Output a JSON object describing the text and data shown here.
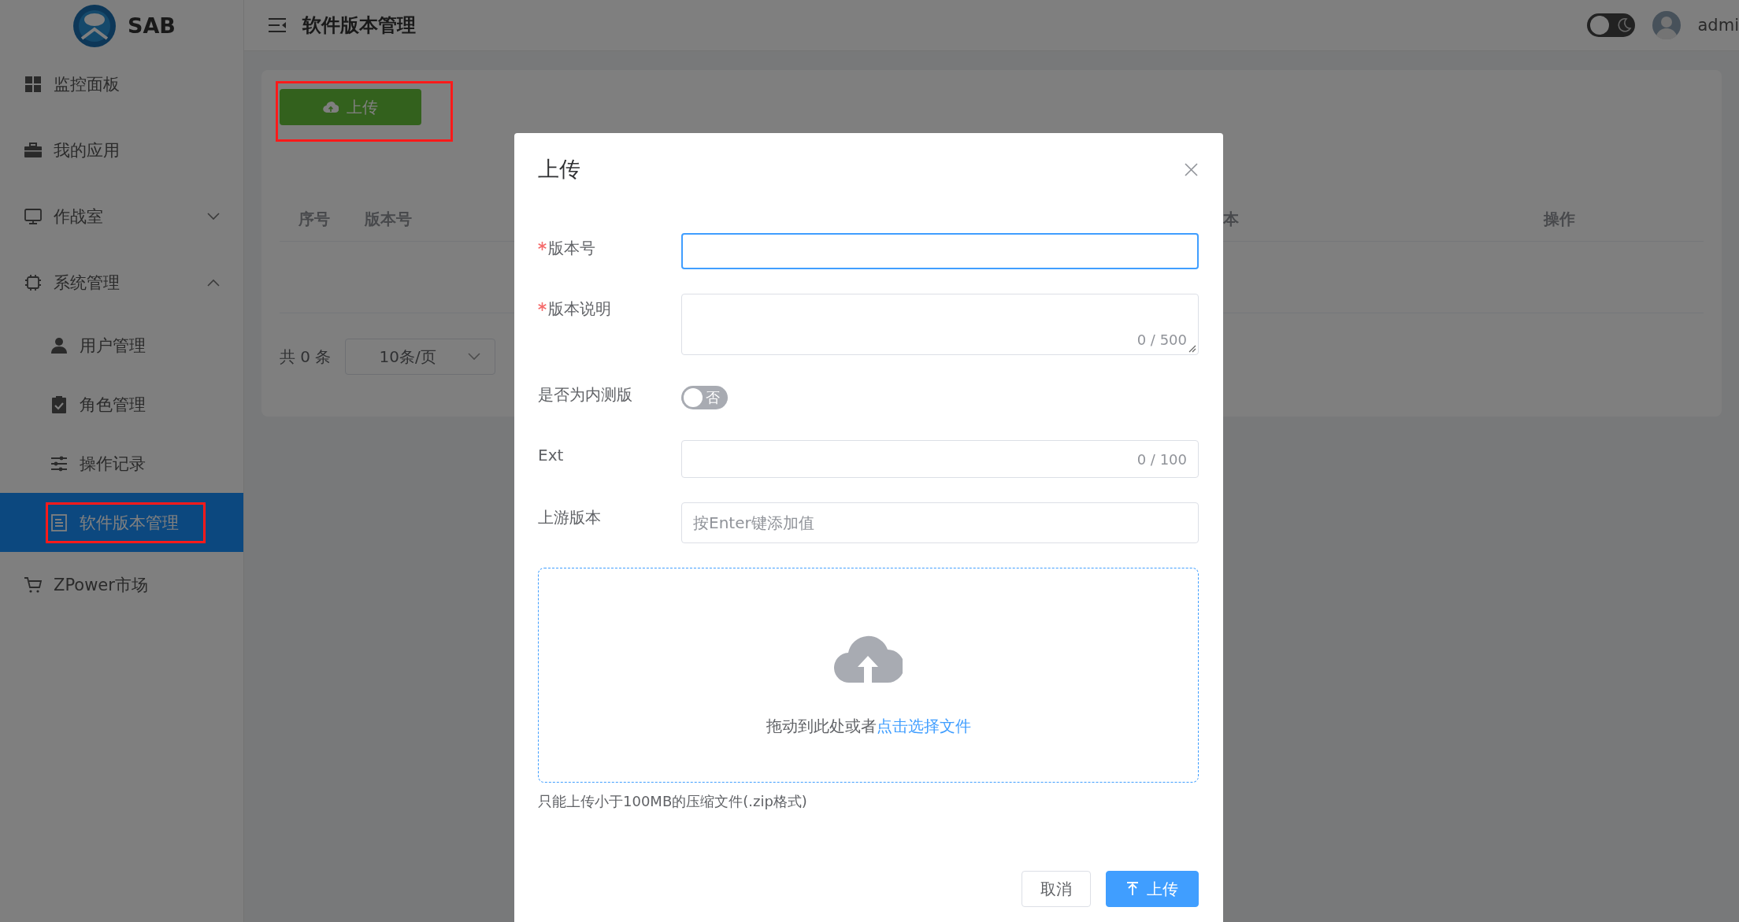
{
  "topbar": {
    "title": "软件版本管理",
    "dark_mode": false,
    "user": "admi"
  },
  "sidebar": {
    "logo_text": "SAB",
    "items": [
      {
        "kind": "link",
        "label": "监控面板",
        "selected": false,
        "highlighted": false
      },
      {
        "kind": "link",
        "label": "我的应用",
        "selected": false,
        "highlighted": false
      },
      {
        "kind": "group",
        "label": "作战室",
        "selected": false,
        "highlighted": false,
        "expanded": false
      },
      {
        "kind": "group",
        "label": "系统管理",
        "selected": false,
        "highlighted": false,
        "expanded": true,
        "children": [
          {
            "label": "用户管理",
            "selected": false,
            "highlighted": false
          },
          {
            "label": "角色管理",
            "selected": false,
            "highlighted": false
          },
          {
            "label": "操作记录",
            "selected": false,
            "highlighted": false
          },
          {
            "label": "软件版本管理",
            "selected": true,
            "highlighted": true
          }
        ]
      },
      {
        "kind": "link",
        "label": "ZPower市场",
        "selected": false,
        "highlighted": false
      }
    ]
  },
  "main": {
    "upload_button": {
      "label": "上传",
      "highlighted": true
    },
    "table": {
      "columns": [
        "序号",
        "版本号",
        "本",
        "操作"
      ]
    },
    "pagination": {
      "total": "共 0 条",
      "page_size": "10条/页"
    }
  },
  "modal": {
    "title": "上传",
    "fields": [
      {
        "kind": "text",
        "label": "版本号",
        "required": true,
        "focused": true
      },
      {
        "kind": "textarea",
        "label": "版本说明",
        "required": true,
        "focused": false,
        "counter": "0 / 500"
      },
      {
        "kind": "switch",
        "label": "是否为内测版",
        "required": false,
        "on": false,
        "text": "否"
      },
      {
        "kind": "text",
        "label": "Ext",
        "required": false,
        "focused": false,
        "counter": "0 / 100"
      },
      {
        "kind": "text",
        "label": "上游版本",
        "required": false,
        "focused": false,
        "placeholder": "按Enter键添加值"
      }
    ],
    "dropzone": {
      "text": "拖动到此处或者",
      "link": "点击选择文件"
    },
    "hint": "只能上传小于100MB的压缩文件(.zip格式)",
    "buttons": [
      {
        "kind": "default",
        "label": "取消"
      },
      {
        "kind": "primary",
        "label": "上传"
      }
    ]
  }
}
